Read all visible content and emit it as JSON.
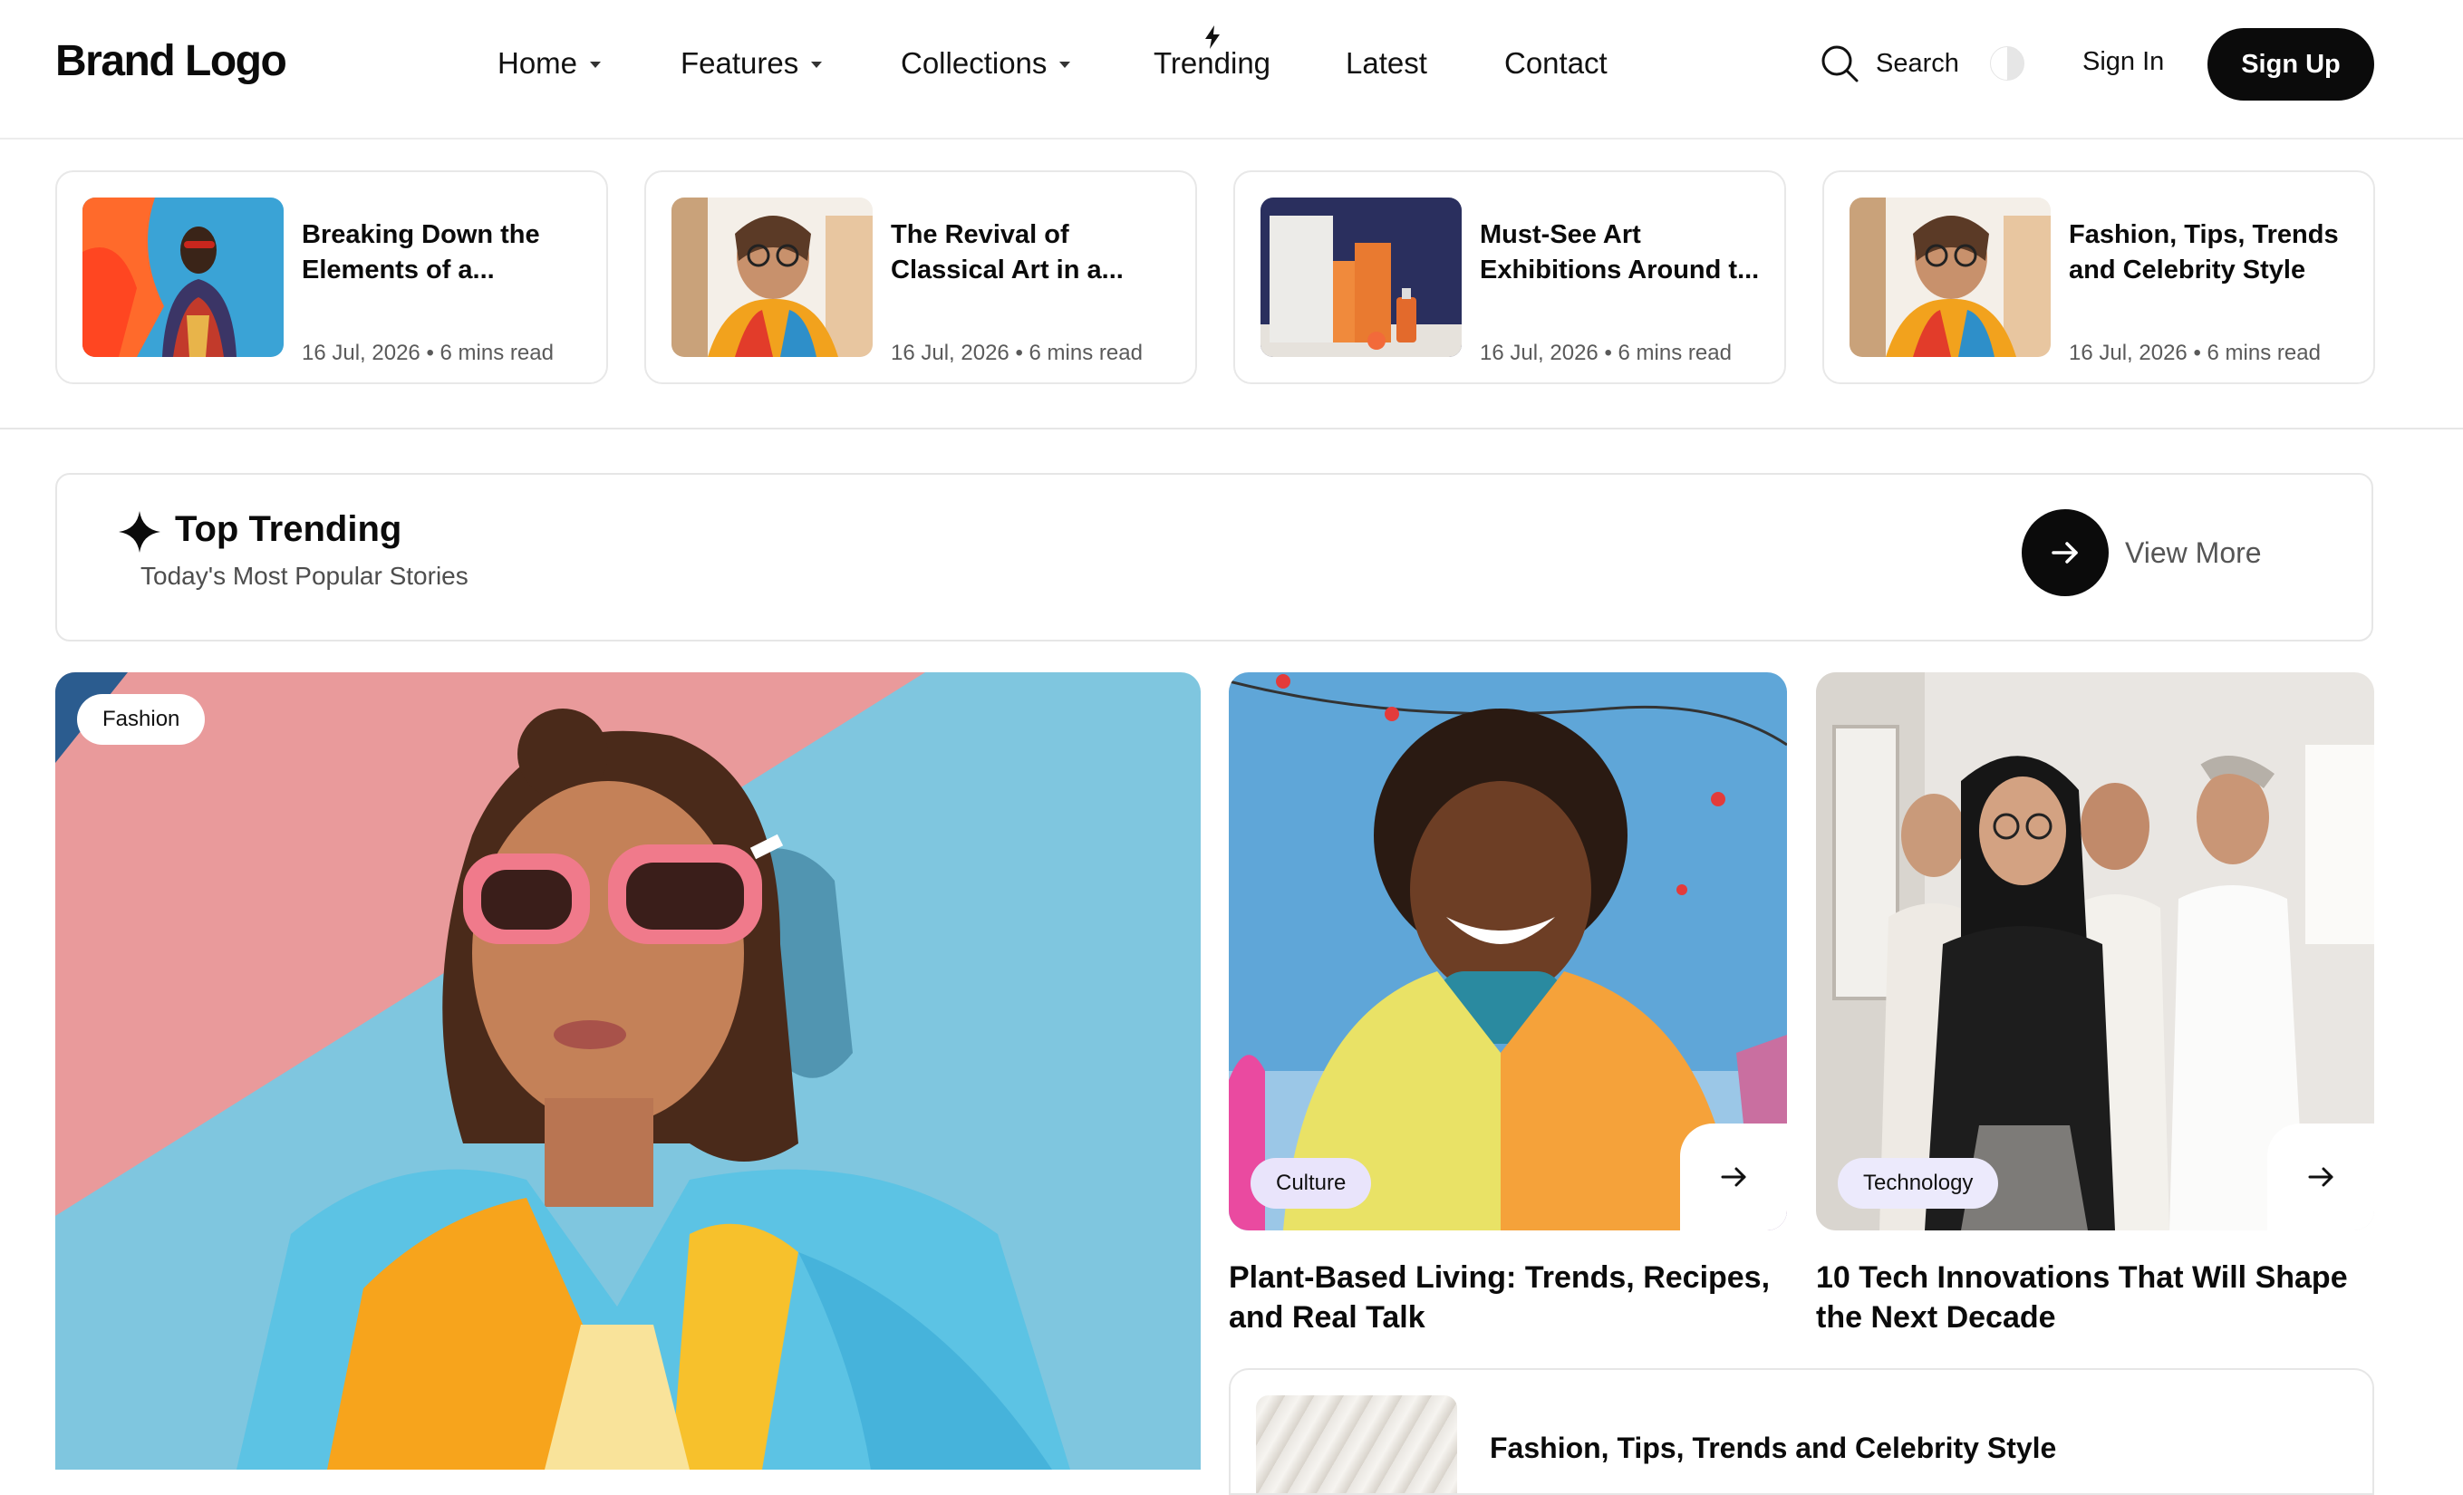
{
  "header": {
    "brand": "Brand Logo",
    "nav": [
      {
        "label": "Home",
        "has_dropdown": true
      },
      {
        "label": "Features",
        "has_dropdown": true
      },
      {
        "label": "Collections",
        "has_dropdown": true
      },
      {
        "label": "Trending",
        "has_dropdown": false,
        "icon": "lightning-icon"
      },
      {
        "label": "Latest",
        "has_dropdown": false
      },
      {
        "label": "Contact",
        "has_dropdown": false
      }
    ],
    "search_label": "Search",
    "theme_toggle_icon": "theme-toggle-icon",
    "signin_label": "Sign In",
    "signup_label": "Sign Up"
  },
  "stories": [
    {
      "title": "Breaking Down the Elements of a...",
      "date": "16 Jul, 2026",
      "read_time": "6 mins read"
    },
    {
      "title": "The Revival of Classical Art in a...",
      "date": "16 Jul, 2026",
      "read_time": "6 mins read"
    },
    {
      "title": "Must-See Art Exhibitions Around t...",
      "date": "16 Jul, 2026",
      "read_time": "6 mins read"
    },
    {
      "title": "Fashion, Tips, Trends and Celebrity Style",
      "date": "16 Jul, 2026",
      "read_time": "6 mins read"
    }
  ],
  "trending": {
    "title": "Top Trending",
    "subtitle": "Today's Most Popular Stories",
    "view_more": "View More"
  },
  "features": {
    "main": {
      "tag": "Fashion"
    },
    "cards": [
      {
        "tag": "Culture",
        "title": "Plant-Based Living: Trends, Recipes, and Real Talk"
      },
      {
        "tag": "Technology",
        "title": "10 Tech Innovations That Will Shape the Next Decade"
      }
    ],
    "bottom": {
      "title": "Fashion, Tips, Trends and Celebrity Style"
    }
  },
  "colors": {
    "accent": "#0b0b0b",
    "text_muted": "#5a5a5a",
    "border": "#e6e6e6",
    "tag_culture_bg": "#e9e4fb",
    "tag_tech_bg": "#eceafc",
    "tag_fashion_bg": "#ffffff"
  }
}
